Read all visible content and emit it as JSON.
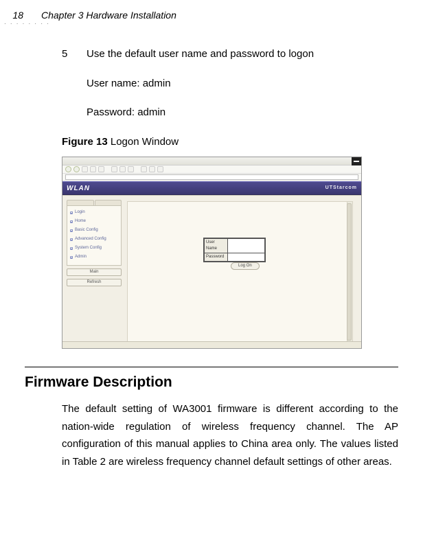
{
  "header": {
    "page_number": "18",
    "chapter": "Chapter 3 Hardware Installation"
  },
  "step": {
    "number": "5",
    "text": "Use the default user name and password to logon",
    "username_line": "User name: admin",
    "password_line": "Password: admin"
  },
  "figure": {
    "label": "Figure 13",
    "title": "Logon Window"
  },
  "screenshot": {
    "wlan_label": "WLAN",
    "brand_label": "UTStarcom",
    "sidebar_items": [
      "Login",
      "Home",
      "Basic Config",
      "Advanced Config",
      "System Config",
      "Admin"
    ],
    "side_btn1": "Main",
    "side_btn2": "Refresh",
    "login_username_label": "User Name",
    "login_password_label": "Password",
    "submit_label": "Log On"
  },
  "section": {
    "title": "Firmware Description",
    "body": "The default setting of WA3001 firmware is different according to the nation-wide regulation of wireless frequency channel. The AP configuration of this manual applies to China area only. The values listed in Table 2 are wireless frequency channel default settings of other areas."
  }
}
